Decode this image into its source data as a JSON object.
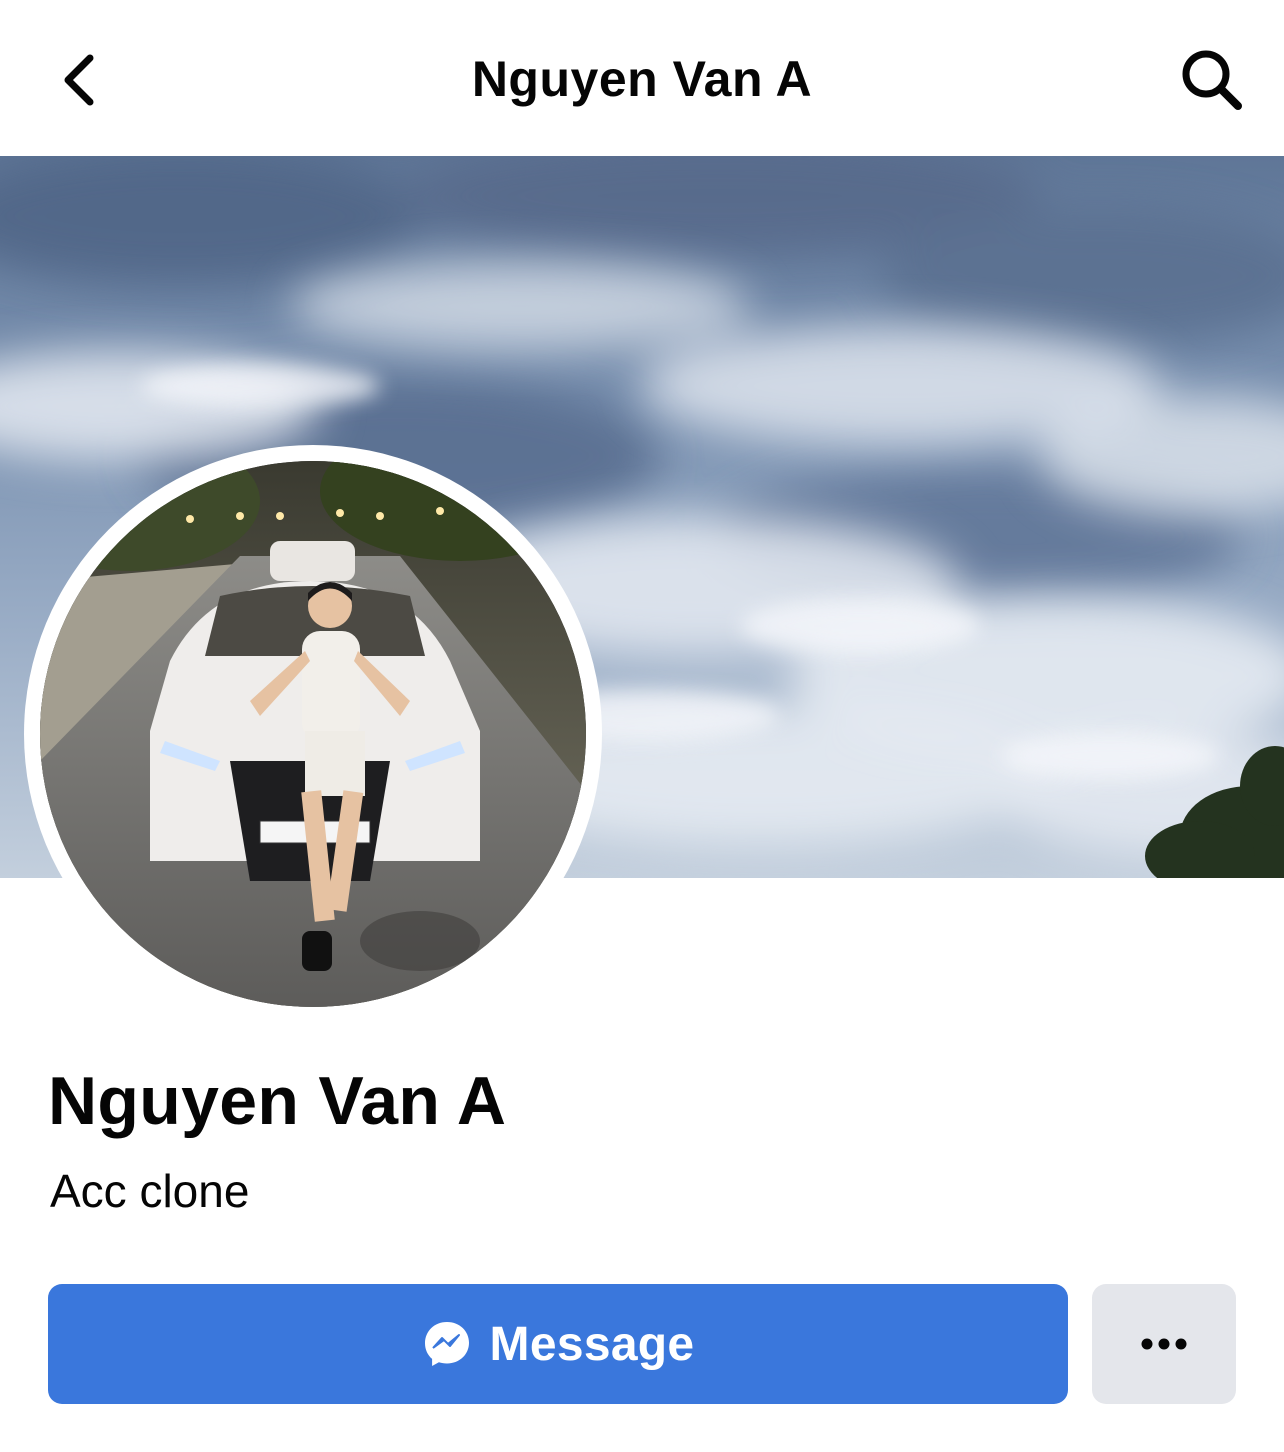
{
  "header": {
    "title": "Nguyen Van A",
    "back_icon": "chevron-left-icon",
    "search_icon": "search-icon"
  },
  "cover": {
    "description_icon": "cover-photo-sky-clouds"
  },
  "avatar": {
    "icon": "profile-picture"
  },
  "profile": {
    "name": "Nguyen Van A",
    "bio": "Acc clone"
  },
  "actions": {
    "message_label": "Message",
    "message_icon": "messenger-icon",
    "more_icon": "more-dots-icon"
  },
  "colors": {
    "primary_button": "#3a77dc",
    "secondary_button": "#e4e6eb",
    "text": "#050505"
  }
}
